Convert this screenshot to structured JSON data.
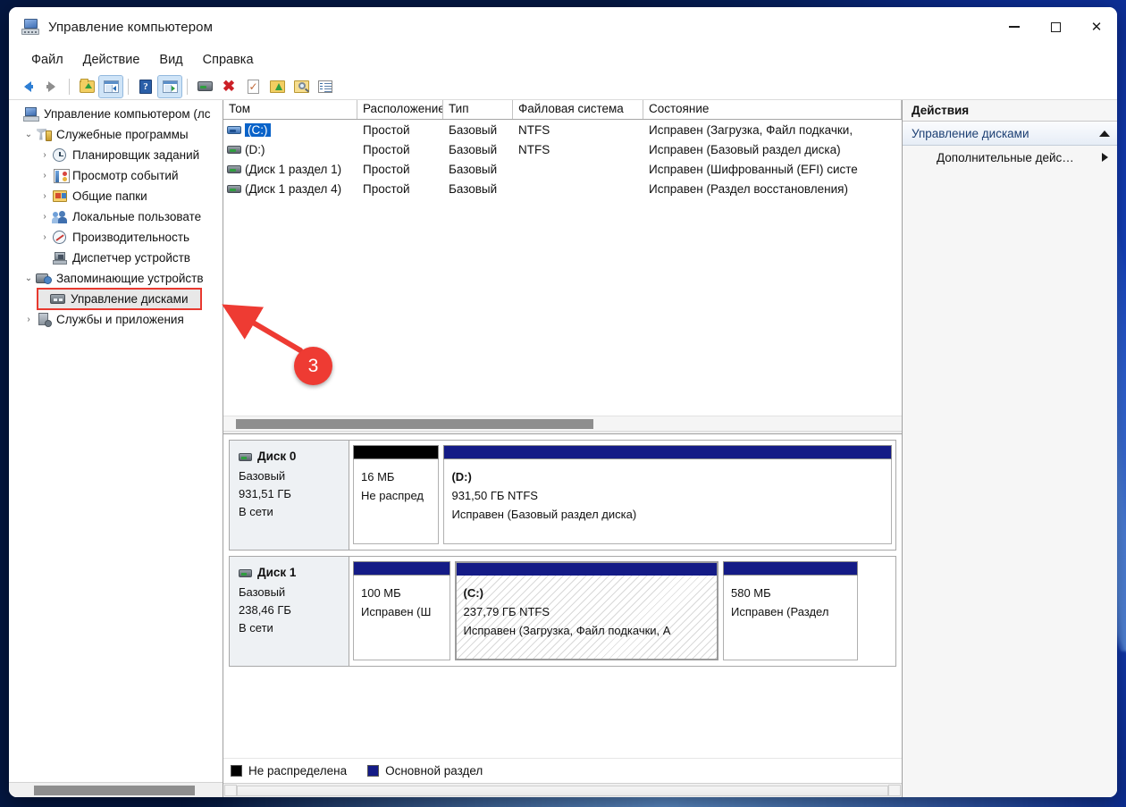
{
  "window": {
    "title": "Управление компьютером",
    "icon": "computer-management-icon",
    "controls": {
      "minimize": "–",
      "maximize": "□",
      "close": "✕"
    }
  },
  "menubar": {
    "items": [
      {
        "label": "Файл"
      },
      {
        "label": "Действие"
      },
      {
        "label": "Вид"
      },
      {
        "label": "Справка"
      }
    ]
  },
  "toolbar": {
    "buttons": [
      {
        "name": "back-icon",
        "label": "Назад"
      },
      {
        "name": "forward-icon",
        "label": "Вперёд"
      },
      {
        "name": "folder-up-icon",
        "label": "Вверх"
      },
      {
        "name": "show-console-tree-icon",
        "label": "Показать дерево консоли"
      },
      {
        "name": "help-icon",
        "label": "Справка"
      },
      {
        "name": "show-action-pane-icon",
        "label": "Показать панель действий"
      },
      {
        "name": "disk-icon",
        "label": "Диск"
      },
      {
        "name": "delete-icon",
        "label": "Удалить"
      },
      {
        "name": "properties-icon",
        "label": "Свойства"
      },
      {
        "name": "folder-green-up-icon",
        "label": "Обновить"
      },
      {
        "name": "search-folder-icon",
        "label": "Поиск"
      },
      {
        "name": "list-view-icon",
        "label": "Список"
      }
    ]
  },
  "tree": {
    "items": [
      {
        "label": "Управление компьютером (лс",
        "icon": "computer-icon",
        "indent": 0,
        "twist": "",
        "state": ""
      },
      {
        "label": "Служебные программы",
        "icon": "tools-icon",
        "indent": 1,
        "twist": "⌄",
        "state": ""
      },
      {
        "label": "Планировщик заданий",
        "icon": "clock-icon",
        "indent": 2,
        "twist": "›",
        "state": ""
      },
      {
        "label": "Просмотр событий",
        "icon": "event-log-icon",
        "indent": 2,
        "twist": "›",
        "state": ""
      },
      {
        "label": "Общие папки",
        "icon": "shared-folders-icon",
        "indent": 2,
        "twist": "›",
        "state": ""
      },
      {
        "label": "Локальные пользовате",
        "icon": "users-icon",
        "indent": 2,
        "twist": "›",
        "state": ""
      },
      {
        "label": "Производительность",
        "icon": "performance-icon",
        "indent": 2,
        "twist": "›",
        "state": ""
      },
      {
        "label": "Диспетчер устройств",
        "icon": "device-manager-icon",
        "indent": 2,
        "twist": "",
        "state": ""
      },
      {
        "label": "Запоминающие устройств",
        "icon": "storage-icon",
        "indent": 1,
        "twist": "⌄",
        "state": ""
      },
      {
        "label": "Управление дисками",
        "icon": "disk-management-icon",
        "indent": 2,
        "twist": "",
        "state": "selected"
      },
      {
        "label": "Службы и приложения",
        "icon": "services-icon",
        "indent": 1,
        "twist": "›",
        "state": ""
      }
    ]
  },
  "volume_list": {
    "columns": [
      {
        "label": "Том"
      },
      {
        "label": "Расположение"
      },
      {
        "label": "Тип"
      },
      {
        "label": "Файловая система"
      },
      {
        "label": "Состояние"
      }
    ],
    "rows": [
      {
        "volume": "(C:)",
        "layout": "Простой",
        "type": "Базовый",
        "fs": "NTFS",
        "status": "Исправен (Загрузка, Файл подкачки,",
        "selected": true,
        "icon_color": "blue"
      },
      {
        "volume": "(D:)",
        "layout": "Простой",
        "type": "Базовый",
        "fs": "NTFS",
        "status": "Исправен (Базовый раздел диска)",
        "selected": false,
        "icon_color": "gray"
      },
      {
        "volume": "(Диск 1 раздел 1)",
        "layout": "Простой",
        "type": "Базовый",
        "fs": "",
        "status": "Исправен (Шифрованный (EFI) систе",
        "selected": false,
        "icon_color": "gray"
      },
      {
        "volume": "(Диск 1 раздел 4)",
        "layout": "Простой",
        "type": "Базовый",
        "fs": "",
        "status": "Исправен (Раздел восстановления)",
        "selected": false,
        "icon_color": "gray"
      }
    ]
  },
  "graphical_view": {
    "disks": [
      {
        "name": "Диск 0",
        "type": "Базовый",
        "size": "931,51 ГБ",
        "state": "В сети",
        "partitions": [
          {
            "label": "",
            "size": "16 МБ",
            "status": "Не распред",
            "bar_color": "#000000",
            "width_pct": 16,
            "hatched": false
          },
          {
            "label": "(D:)",
            "size": "931,50 ГБ NTFS",
            "status": "Исправен (Базовый раздел диска)",
            "bar_color": "#141b86",
            "width_pct": 84,
            "hatched": false
          }
        ]
      },
      {
        "name": "Диск 1",
        "type": "Базовый",
        "size": "238,46 ГБ",
        "state": "В сети",
        "partitions": [
          {
            "label": "",
            "size": "100 МБ",
            "status": "Исправен (Ш",
            "bar_color": "#141b86",
            "width_pct": 18,
            "hatched": false
          },
          {
            "label": "(C:)",
            "size": "237,79 ГБ NTFS",
            "status": "Исправен (Загрузка, Файл подкачки, А",
            "bar_color": "#141b86",
            "width_pct": 52,
            "hatched": true
          },
          {
            "label": "",
            "size": "580 МБ",
            "status": "Исправен (Раздел",
            "bar_color": "#141b86",
            "width_pct": 25,
            "hatched": false
          }
        ]
      }
    ]
  },
  "legend": {
    "items": [
      {
        "label": "Не распределена",
        "color": "#000000"
      },
      {
        "label": "Основной раздел",
        "color": "#141b86"
      }
    ]
  },
  "actions": {
    "header": "Действия",
    "group": {
      "label": "Управление дисками",
      "collapse_icon": "chevron-up-icon"
    },
    "items": [
      {
        "label": "Дополнительные дейс…",
        "submenu_icon": "chevron-right-icon"
      }
    ]
  },
  "annotation": {
    "badge_number": "3",
    "arrow_color": "#ee3b33",
    "target": "Управление дисками"
  },
  "colors": {
    "accent": "#0a63c9",
    "primary_partition": "#141b86",
    "unallocated": "#000000",
    "annotation_red": "#ee3b33"
  }
}
